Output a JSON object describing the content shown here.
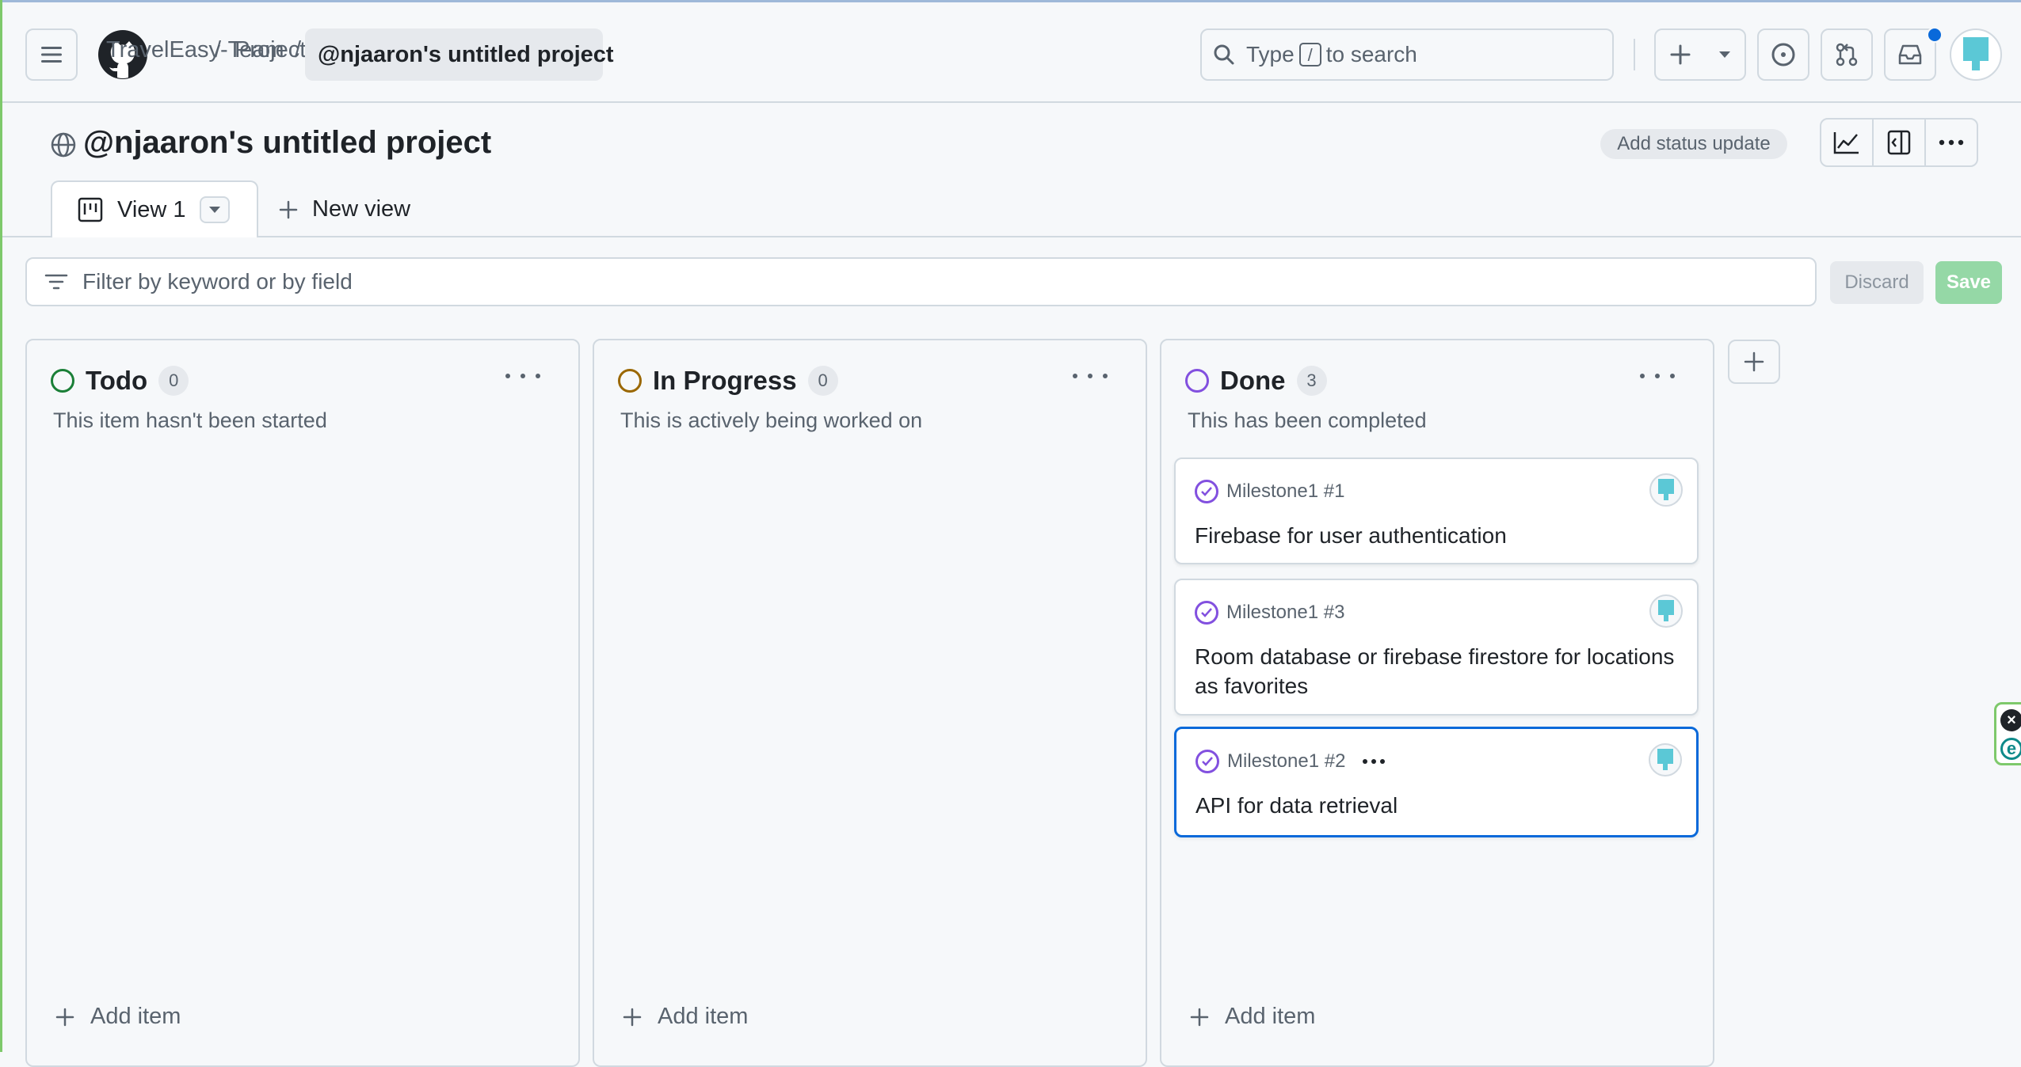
{
  "breadcrumb": {
    "org": "TravelEasy-Team",
    "projects": "Projects",
    "current": "@njaaron's untitled project",
    "separator": "/"
  },
  "search": {
    "prefix": "Type",
    "kbd": "/",
    "suffix": "to search"
  },
  "project": {
    "title": "@njaaron's untitled project",
    "status_button": "Add status update"
  },
  "tabs": {
    "active": "View 1",
    "new_view": "New view"
  },
  "filter": {
    "placeholder": "Filter by keyword or by field",
    "discard": "Discard",
    "save": "Save"
  },
  "columns": [
    {
      "name": "Todo",
      "count": "0",
      "description": "This item hasn't been started",
      "color": "#1a7f37",
      "add_item": "Add item",
      "cards": []
    },
    {
      "name": "In Progress",
      "count": "0",
      "description": "This is actively being worked on",
      "color": "#9a6700",
      "add_item": "Add item",
      "cards": []
    },
    {
      "name": "Done",
      "count": "3",
      "description": "This has been completed",
      "color": "#8250df",
      "add_item": "Add item",
      "cards": [
        {
          "ref": "Milestone1 #1",
          "title": "Firebase for user authentication"
        },
        {
          "ref": "Milestone1 #3",
          "title": "Room database or firebase firestore for locations as favorites"
        },
        {
          "ref": "Milestone1 #2",
          "title": "API for data retrieval",
          "selected": true
        }
      ]
    }
  ],
  "colors": {
    "accent_blue": "#0969da",
    "done_purple": "#8250df",
    "avatar_teal": "#5bc8d6",
    "save_green": "#95d8a6"
  },
  "icons": {
    "menu": "hamburger-icon",
    "logo": "github-logo",
    "search": "search-icon",
    "plus": "plus-icon",
    "issue": "issue-opened-icon",
    "pr": "git-pull-request-icon",
    "inbox": "inbox-icon",
    "globe": "globe-icon",
    "insights": "graph-icon",
    "sidepanel": "sidebar-icon",
    "more": "kebab-horizontal-icon",
    "board": "project-board-icon",
    "filter": "filter-icon"
  }
}
